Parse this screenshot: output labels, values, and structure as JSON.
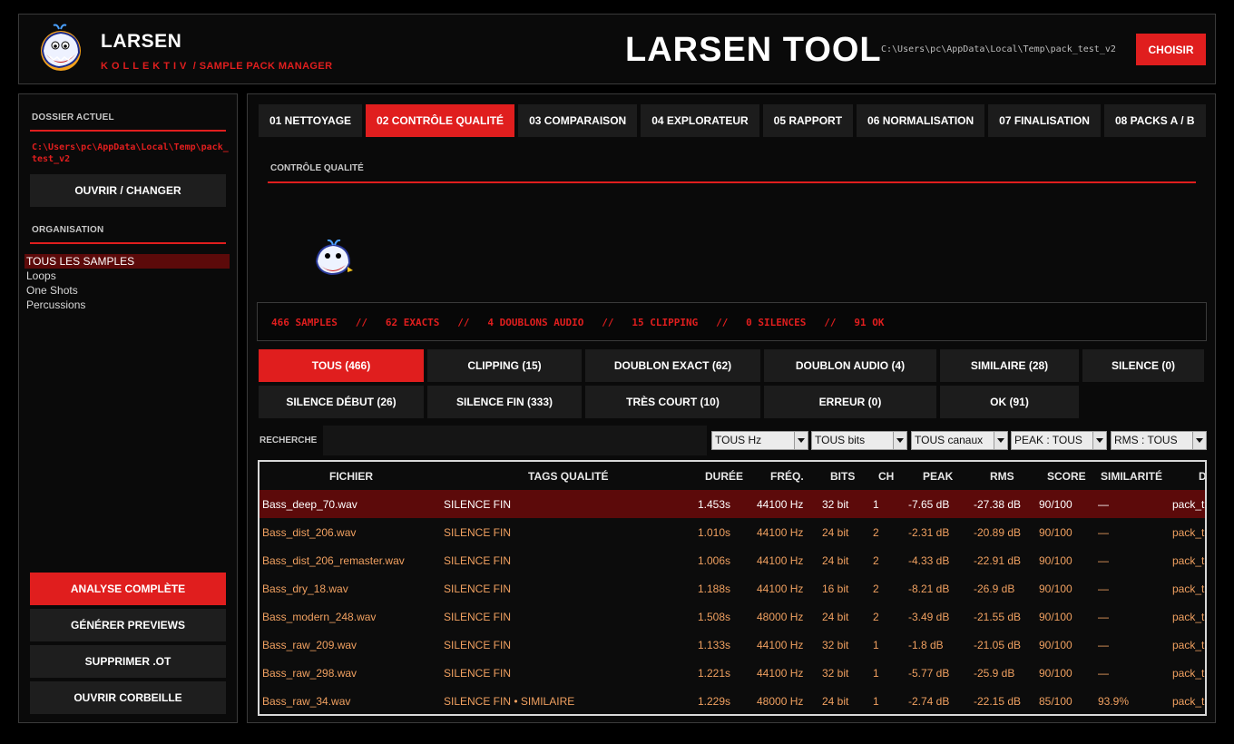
{
  "colors": {
    "accent": "#e01e1e",
    "row_text": "#f0a060",
    "selected_row": "#5c0a0a"
  },
  "header": {
    "app_name": "LARSEN",
    "subtitle_kollektiv": "KOLLEKTIV",
    "subtitle_sep": " / ",
    "subtitle_rest": "SAMPLE PACK MANAGER",
    "big_title": "LARSEN TOOL",
    "path": "C:\\Users\\pc\\AppData\\Local\\Temp\\pack_test_v2",
    "choose_label": "CHOISIR"
  },
  "sidebar": {
    "current_folder_heading": "DOSSIER ACTUEL",
    "current_path": "C:\\Users\\pc\\AppData\\Local\\Temp\\pack_test_v2",
    "open_label": "OUVRIR / CHANGER",
    "organisation_heading": "ORGANISATION",
    "org_items": [
      "TOUS LES SAMPLES",
      "Loops",
      "One Shots",
      "Percussions"
    ],
    "actions": {
      "full_analysis": "ANALYSE COMPLÈTE",
      "generate_previews": "GÉNÉRER PREVIEWS",
      "delete_ot": "SUPPRIMER .OT",
      "open_trash": "OUVRIR CORBEILLE"
    }
  },
  "tabs": [
    "01 NETTOYAGE",
    "02 CONTRÔLE QUALITÉ",
    "03 COMPARAISON",
    "04 EXPLORATEUR",
    "05 RAPPORT",
    "06 NORMALISATION",
    "07 FINALISATION",
    "08 PACKS A / B"
  ],
  "section_title": "CONTRÔLE QUALITÉ",
  "stats": "466 SAMPLES   //   62 EXACTS   //   4 DOUBLONS AUDIO   //   15 CLIPPING   //   0 SILENCES   //   91 OK",
  "filters": {
    "all": "TOUS (466)",
    "clipping": "CLIPPING (15)",
    "exact_dup": "DOUBLON EXACT (62)",
    "audio_dup": "DOUBLON AUDIO (4)",
    "similar": "SIMILAIRE (28)",
    "silence": "SILENCE (0)",
    "silence_start": "SILENCE DÉBUT (26)",
    "silence_end": "SILENCE FIN (333)",
    "very_short": "TRÈS COURT (10)",
    "error": "ERREUR (0)",
    "ok": "OK (91)"
  },
  "search": {
    "label": "RECHERCHE",
    "value": ""
  },
  "dropdowns": {
    "hz": "TOUS Hz",
    "bits": "TOUS bits",
    "channels": "TOUS canaux",
    "peak": "PEAK : TOUS",
    "rms": "RMS : TOUS"
  },
  "table": {
    "headers": {
      "file": "FICHIER",
      "tags": "TAGS QUALITÉ",
      "duration": "DURÉE",
      "freq": "FRÉQ.",
      "bits": "BITS",
      "ch": "CH",
      "peak": "PEAK",
      "rms": "RMS",
      "score": "SCORE",
      "similarity": "SIMILARITÉ",
      "dest": "D"
    },
    "rows": [
      {
        "file": "Bass_deep_70.wav",
        "tags": "SILENCE FIN",
        "duration": "1.453s",
        "freq": "44100 Hz",
        "bits": "32 bit",
        "ch": "1",
        "peak": "-7.65 dB",
        "rms": "-27.38 dB",
        "score": "90/100",
        "similarity": "—",
        "dest": "pack_t"
      },
      {
        "file": "Bass_dist_206.wav",
        "tags": "SILENCE FIN",
        "duration": "1.010s",
        "freq": "44100 Hz",
        "bits": "24 bit",
        "ch": "2",
        "peak": "-2.31 dB",
        "rms": "-20.89 dB",
        "score": "90/100",
        "similarity": "—",
        "dest": "pack_t"
      },
      {
        "file": "Bass_dist_206_remaster.wav",
        "tags": "SILENCE FIN",
        "duration": "1.006s",
        "freq": "44100 Hz",
        "bits": "24 bit",
        "ch": "2",
        "peak": "-4.33 dB",
        "rms": "-22.91 dB",
        "score": "90/100",
        "similarity": "—",
        "dest": "pack_t"
      },
      {
        "file": "Bass_dry_18.wav",
        "tags": "SILENCE FIN",
        "duration": "1.188s",
        "freq": "44100 Hz",
        "bits": "16 bit",
        "ch": "2",
        "peak": "-8.21 dB",
        "rms": "-26.9 dB",
        "score": "90/100",
        "similarity": "—",
        "dest": "pack_t"
      },
      {
        "file": "Bass_modern_248.wav",
        "tags": "SILENCE FIN",
        "duration": "1.508s",
        "freq": "48000 Hz",
        "bits": "24 bit",
        "ch": "2",
        "peak": "-3.49 dB",
        "rms": "-21.55 dB",
        "score": "90/100",
        "similarity": "—",
        "dest": "pack_t"
      },
      {
        "file": "Bass_raw_209.wav",
        "tags": "SILENCE FIN",
        "duration": "1.133s",
        "freq": "44100 Hz",
        "bits": "32 bit",
        "ch": "1",
        "peak": "-1.8 dB",
        "rms": "-21.05 dB",
        "score": "90/100",
        "similarity": "—",
        "dest": "pack_t"
      },
      {
        "file": "Bass_raw_298.wav",
        "tags": "SILENCE FIN",
        "duration": "1.221s",
        "freq": "44100 Hz",
        "bits": "32 bit",
        "ch": "1",
        "peak": "-5.77 dB",
        "rms": "-25.9 dB",
        "score": "90/100",
        "similarity": "—",
        "dest": "pack_t"
      },
      {
        "file": "Bass_raw_34.wav",
        "tags": "SILENCE FIN • SIMILAIRE",
        "duration": "1.229s",
        "freq": "48000 Hz",
        "bits": "24 bit",
        "ch": "1",
        "peak": "-2.74 dB",
        "rms": "-22.15 dB",
        "score": "85/100",
        "similarity": "93.9%",
        "dest": "pack_t"
      }
    ]
  }
}
